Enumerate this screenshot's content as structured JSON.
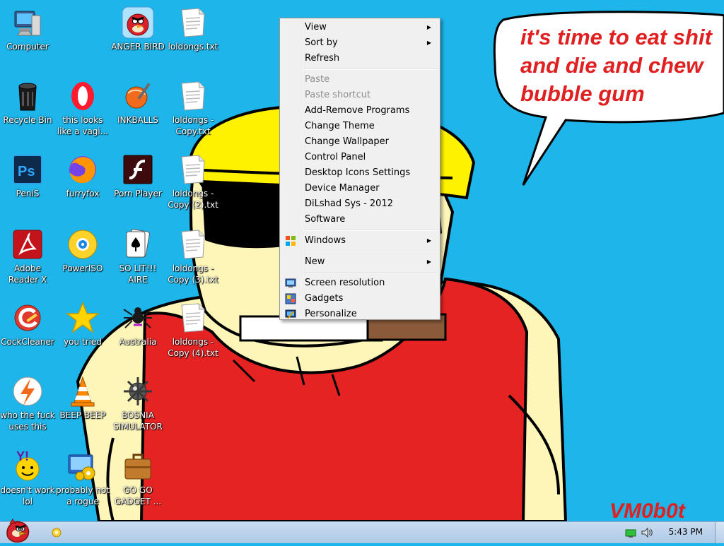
{
  "desktop": {
    "icons": [
      {
        "label": "Computer",
        "icon": "computer-icon"
      },
      {
        "label": "Recycle Bin",
        "icon": "recycle-bin-icon"
      },
      {
        "label": "PeniS",
        "icon": "photoshop-icon"
      },
      {
        "label": "Adobe Reader X",
        "icon": "adobe-reader-icon"
      },
      {
        "label": "CockCleaner",
        "icon": "ccleaner-icon"
      },
      {
        "label": "who the fuck uses this",
        "icon": "winamp-icon"
      },
      {
        "label": "doesn't work lol",
        "icon": "yahoo-messenger-icon"
      },
      {
        "label": "this looks like a vagi...",
        "icon": "opera-icon"
      },
      {
        "label": "furryfox",
        "icon": "firefox-icon"
      },
      {
        "label": "PowerISO",
        "icon": "poweriso-icon"
      },
      {
        "label": "you tried",
        "icon": "star-icon"
      },
      {
        "label": "BEEP BEEP",
        "icon": "vlc-cone-icon"
      },
      {
        "label": "probably not a rogue",
        "icon": "gears-program-icon"
      },
      {
        "label": "ANGER BIRD",
        "icon": "angry-bird-icon"
      },
      {
        "label": "INKBALLS",
        "icon": "inkball-icon"
      },
      {
        "label": "Porn Player",
        "icon": "flash-player-icon"
      },
      {
        "label": "SO LIT!!! AIRE",
        "icon": "solitaire-cards-icon"
      },
      {
        "label": "Australia",
        "icon": "spider-solitaire-icon"
      },
      {
        "label": "BOSNIA SIMULATOR",
        "icon": "minesweeper-mine-icon"
      },
      {
        "label": "GO GO GADGET ...",
        "icon": "briefcase-icon"
      },
      {
        "label": "loldongs.txt",
        "icon": "text-file-icon"
      },
      {
        "label": "loldongs - Copy.txt",
        "icon": "text-file-icon"
      },
      {
        "label": "loldongs - Copy (2).txt",
        "icon": "text-file-icon"
      },
      {
        "label": "loldongs - Copy (3).txt",
        "icon": "text-file-icon"
      },
      {
        "label": "loldongs - Copy (4).txt",
        "icon": "text-file-icon"
      }
    ]
  },
  "wallpaper": {
    "speech_bubble": "it's time to eat shit and die and chew bubble gum",
    "signature": "VM0b0t"
  },
  "context_menu": {
    "items": [
      {
        "label": "View",
        "submenu": true,
        "enabled": true
      },
      {
        "label": "Sort by",
        "submenu": true,
        "enabled": true
      },
      {
        "label": "Refresh",
        "enabled": true
      },
      {
        "label": "Paste",
        "enabled": false
      },
      {
        "label": "Paste shortcut",
        "enabled": false
      },
      {
        "label": "Add-Remove Programs",
        "enabled": true
      },
      {
        "label": "Change Theme",
        "enabled": true
      },
      {
        "label": "Change Wallpaper",
        "enabled": true
      },
      {
        "label": "Control Panel",
        "enabled": true
      },
      {
        "label": "Desktop Icons Settings",
        "enabled": true
      },
      {
        "label": "Device Manager",
        "enabled": true
      },
      {
        "label": "DiLshad Sys - 2012",
        "enabled": true
      },
      {
        "label": "Software",
        "enabled": true
      },
      {
        "label": "Windows",
        "submenu": true,
        "enabled": true,
        "icon": "windows-flag-icon"
      },
      {
        "label": "New",
        "submenu": true,
        "enabled": true
      },
      {
        "label": "Screen resolution",
        "enabled": true,
        "icon": "monitor-icon"
      },
      {
        "label": "Gadgets",
        "enabled": true,
        "icon": "gadgets-icon"
      },
      {
        "label": "Personalize",
        "enabled": true,
        "icon": "personalize-icon"
      }
    ]
  },
  "taskbar": {
    "start_icon": "angry-bird-start-icon",
    "tray_icons": [
      "network-icon",
      "volume-icon"
    ],
    "clock": "5:43 PM"
  },
  "colors": {
    "desktop_bg": "#1db5ea",
    "menu_bg": "#f0f0f0",
    "shirt": "#e52323",
    "skin": "#fdf6b8",
    "helmet": "#fff200"
  }
}
